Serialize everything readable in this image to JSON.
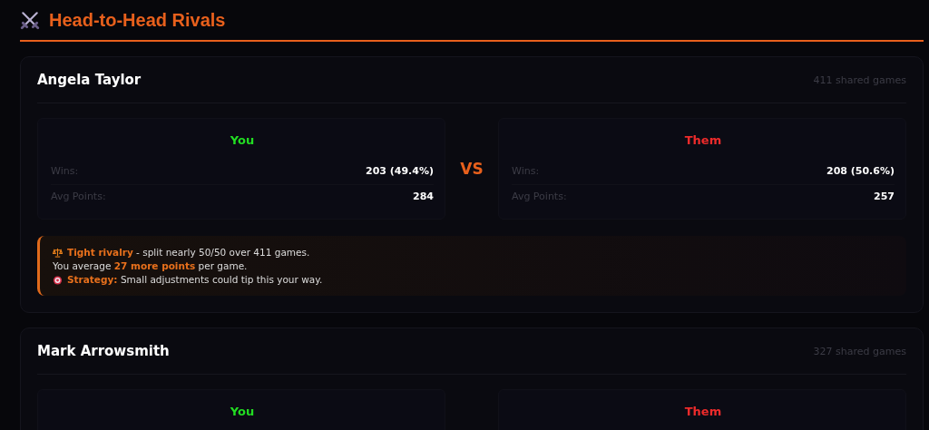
{
  "header": {
    "title": "Head-to-Head Rivals"
  },
  "rivals": [
    {
      "name": "Angela Taylor",
      "shared_games": "411 shared games",
      "vs": "VS",
      "sides": [
        {
          "kind": "you",
          "label": "You",
          "stats": [
            {
              "label": "Wins:",
              "value": "203 (49.4%)"
            },
            {
              "label": "Avg Points:",
              "value": "284"
            }
          ]
        },
        {
          "kind": "them",
          "label": "Them",
          "stats": [
            {
              "label": "Wins:",
              "value": "208 (50.6%)"
            },
            {
              "label": "Avg Points:",
              "value": "257"
            }
          ]
        }
      ],
      "insights": [
        {
          "kind": "balance",
          "text": "**Tight rivalry** - split nearly 50/50 over 411 games."
        },
        {
          "kind": "plain",
          "text": "You average **27 more points** per game."
        },
        {
          "kind": "strategy",
          "text": "**Strategy:** Small adjustments could tip this your way."
        }
      ]
    },
    {
      "name": "Mark Arrowsmith",
      "shared_games": "327 shared games",
      "sides": [
        {
          "kind": "you",
          "label": "You"
        },
        {
          "kind": "them",
          "label": "Them"
        }
      ]
    }
  ]
}
